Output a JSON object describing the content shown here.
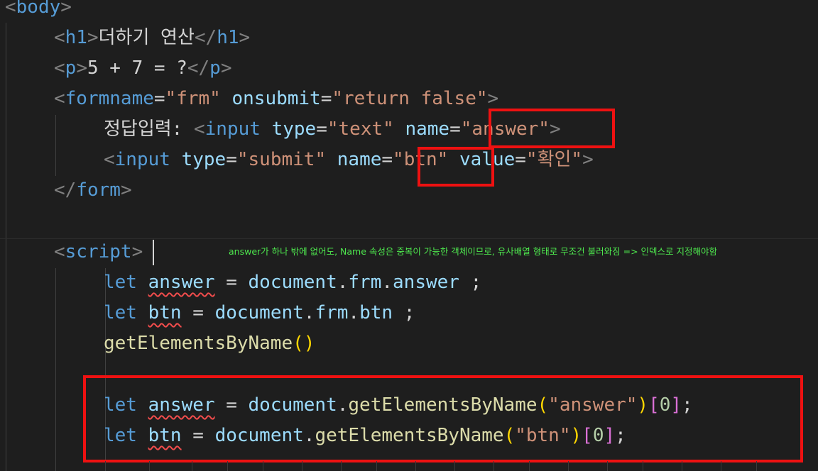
{
  "code": {
    "body_tag": "body",
    "h1_tag": "h1",
    "h1_text": "더하기 연산",
    "p_tag": "p",
    "p_text": "5 + 7 = ?",
    "form_tag": "formname",
    "form_name_value": "\"frm\"",
    "onsubmit_attr": "onsubmit",
    "onsubmit_value": "\"return false\"",
    "answer_label": "정답입력: ",
    "input_tag": "input",
    "type_attr": "type",
    "type_text_value": "\"text\"",
    "name_attr": "name",
    "answer_name_value": "\"answer\"",
    "type_submit_value": "\"submit\"",
    "btn_name_value": "\"btn\"",
    "value_attr": "value",
    "confirm_value": "\"확인\"",
    "form_close_tag": "form",
    "script_tag": "script",
    "kw_let": "let",
    "var_answer": "answer",
    "var_btn": "btn",
    "obj_document": "document",
    "prop_frm": "frm",
    "prop_answer": "answer",
    "prop_btn": "btn",
    "fn_getElementsByName": "getElementsByName",
    "arg_answer": "\"answer\"",
    "arg_btn": "\"btn\"",
    "index_zero": "0"
  },
  "annotation": "answer가 하나 밖에 없어도, Name 속성은 중복이 가능한 객체이므로, 유사배열 형태로 무조건 불러와짐 => 인덱스로 지정해야함",
  "colors": {
    "highlight_box": "#ee1111",
    "annotation_text": "#4ee84e"
  }
}
